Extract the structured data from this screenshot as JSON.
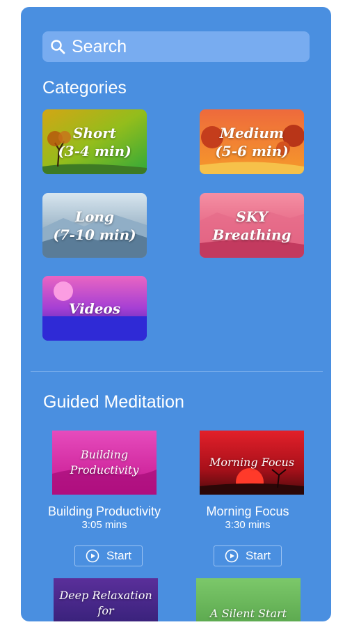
{
  "search": {
    "placeholder": "Search"
  },
  "categories": {
    "title": "Categories",
    "items": [
      {
        "line1": "Short",
        "line2": "(3-4 min)"
      },
      {
        "line1": "Medium",
        "line2": "(5-6 min)"
      },
      {
        "line1": "Long",
        "line2": "(7-10 min)"
      },
      {
        "line1": "SKY",
        "line2": "Breathing"
      },
      {
        "line1": "Videos",
        "line2": ""
      }
    ]
  },
  "guided": {
    "title": "Guided Meditation",
    "cards": [
      {
        "thumb_line1": "Building",
        "thumb_line2": "Productivity",
        "title": "Building Productivity",
        "duration": "3:05 mins",
        "start": "Start"
      },
      {
        "thumb_line1": "Morning Focus",
        "thumb_line2": "",
        "title": "Morning Focus",
        "duration": "3:30 mins",
        "start": "Start"
      },
      {
        "thumb_line1": "Deep Relaxation",
        "thumb_line2": "for",
        "title": "",
        "duration": "",
        "start": ""
      },
      {
        "thumb_line1": "A Silent Start",
        "thumb_line2": "",
        "title": "",
        "duration": "",
        "start": ""
      }
    ]
  },
  "colors": {
    "panel": "#4a8fe0",
    "search_bg": "#78acf0",
    "text": "#ffffff"
  },
  "icons": {
    "search": "search-icon",
    "play": "play-circle-icon"
  }
}
